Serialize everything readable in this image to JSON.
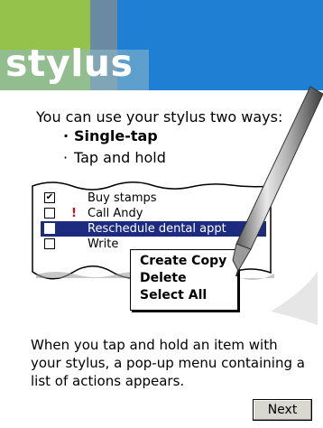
{
  "header": {
    "title": "stylus"
  },
  "intro": {
    "text": "You can use your stylus two ways:",
    "bullets": [
      "Single-tap",
      "Tap and hold"
    ]
  },
  "todo_list": {
    "items": [
      {
        "label": "Buy stamps",
        "checked": true,
        "priority": ""
      },
      {
        "label": "Call Andy",
        "checked": false,
        "priority": "!"
      },
      {
        "label": "Reschedule dental appt",
        "checked": false,
        "priority": ""
      },
      {
        "label": "Write",
        "checked": false,
        "priority": ""
      }
    ]
  },
  "popup_menu": {
    "items": [
      "Create Copy",
      "Delete",
      "Select All"
    ]
  },
  "description": "When you tap and hold an item with your stylus, a pop-up menu containing a list of actions appears.",
  "next_button": "Next",
  "colors": {
    "header_blue": "#1f7fd3",
    "header_green": "#94c24a",
    "selection": "#1c2b80",
    "priority_red": "#d01010"
  }
}
